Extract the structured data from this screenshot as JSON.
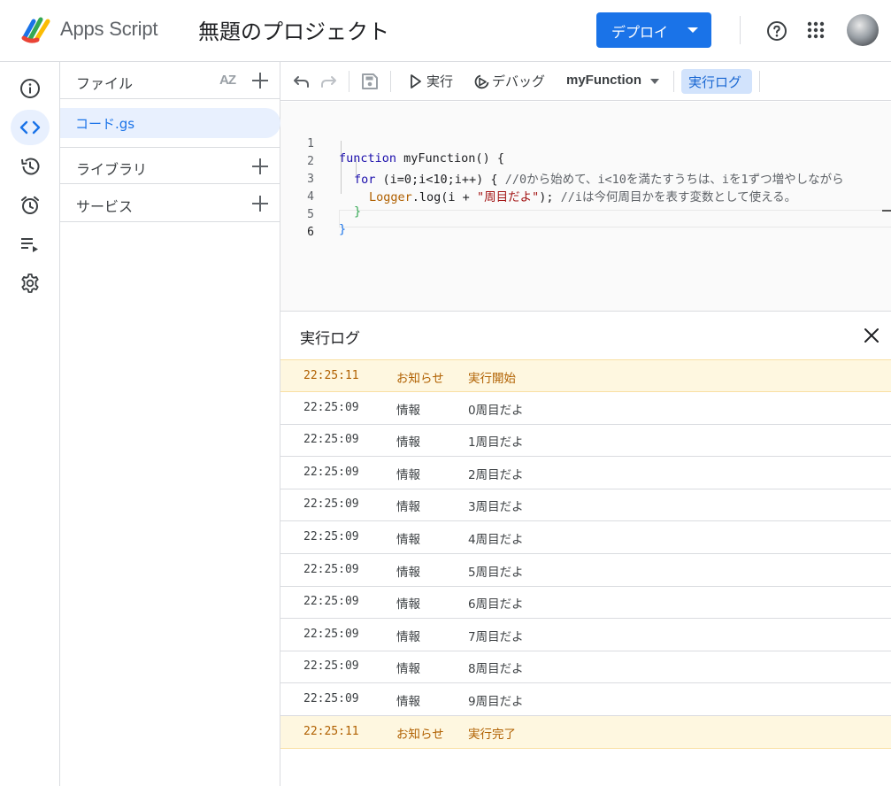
{
  "header": {
    "app_name": "Apps Script",
    "project_title": "無題のプロジェクト",
    "deploy_label": "デプロイ",
    "icons": [
      "apps-script-logo",
      "help-icon",
      "apps-grid-icon",
      "avatar"
    ]
  },
  "rail": {
    "items": [
      {
        "name": "overview",
        "icon": "info-icon"
      },
      {
        "name": "editor",
        "icon": "code-icon",
        "active": true
      },
      {
        "name": "history",
        "icon": "history-icon"
      },
      {
        "name": "triggers",
        "icon": "alarm-icon"
      },
      {
        "name": "executions",
        "icon": "executions-icon"
      },
      {
        "name": "settings",
        "icon": "gear-icon"
      }
    ]
  },
  "files": {
    "header_label": "ファイル",
    "items": [
      "コード.gs"
    ],
    "libraries_label": "ライブラリ",
    "services_label": "サービス"
  },
  "toolbar": {
    "run_label": "実行",
    "debug_label": "デバッグ",
    "function_name": "myFunction",
    "log_label": "実行ログ"
  },
  "editor": {
    "line_numbers": [
      "1",
      "2",
      "3",
      "4",
      "5",
      "6"
    ],
    "lines": {
      "l1_kw": "function",
      "l1_rest": " myFunction() {",
      "l2_kw": "for",
      "l2_code": " (i=0;i<10;i++) { ",
      "l2_comment": "//0から始めて、i<10を満たすうちは、iを1ずつ増やしながら",
      "l3_obj": "Logger",
      "l3_a": ".log(i + ",
      "l3_str": "\"周目だよ\"",
      "l3_b": "); ",
      "l3_comment": "//iは今何周目かを表す変数として使える。",
      "l4": "}",
      "l5": "}"
    }
  },
  "log": {
    "title": "実行ログ",
    "rows": [
      {
        "time": "22:25:11",
        "level": "お知らせ",
        "message": "実行開始",
        "type": "notice"
      },
      {
        "time": "22:25:09",
        "level": "情報",
        "message": "0周目だよ",
        "type": "info"
      },
      {
        "time": "22:25:09",
        "level": "情報",
        "message": "1周目だよ",
        "type": "info"
      },
      {
        "time": "22:25:09",
        "level": "情報",
        "message": "2周目だよ",
        "type": "info"
      },
      {
        "time": "22:25:09",
        "level": "情報",
        "message": "3周目だよ",
        "type": "info"
      },
      {
        "time": "22:25:09",
        "level": "情報",
        "message": "4周目だよ",
        "type": "info"
      },
      {
        "time": "22:25:09",
        "level": "情報",
        "message": "5周目だよ",
        "type": "info"
      },
      {
        "time": "22:25:09",
        "level": "情報",
        "message": "6周目だよ",
        "type": "info"
      },
      {
        "time": "22:25:09",
        "level": "情報",
        "message": "7周目だよ",
        "type": "info"
      },
      {
        "time": "22:25:09",
        "level": "情報",
        "message": "8周目だよ",
        "type": "info"
      },
      {
        "time": "22:25:09",
        "level": "情報",
        "message": "9周目だよ",
        "type": "info"
      },
      {
        "time": "22:25:11",
        "level": "お知らせ",
        "message": "実行完了",
        "type": "notice"
      }
    ]
  },
  "colors": {
    "primary": "#1a73e8",
    "notice_bg": "#fef7e0",
    "notice_text": "#b06000"
  }
}
